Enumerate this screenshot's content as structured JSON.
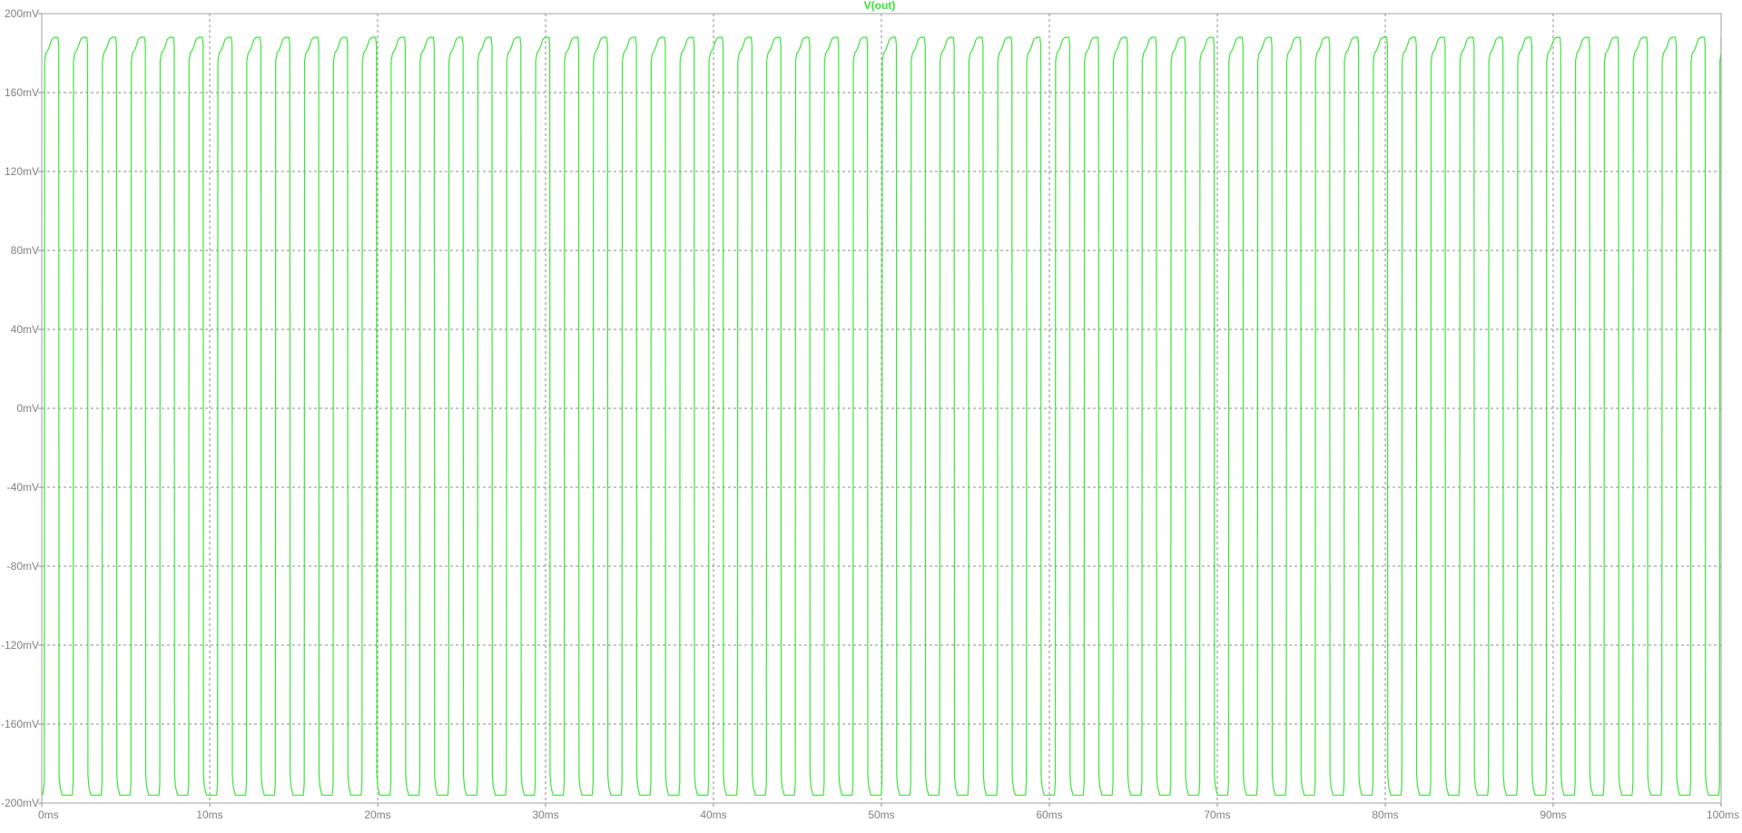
{
  "window": {
    "background": "#ffffff",
    "trace_color": "#3ae63a",
    "grid_color": "#8c8c8c",
    "label_color": "#808080"
  },
  "chart_data": {
    "type": "line",
    "title": "V(out)",
    "xlabel": "",
    "ylabel": "",
    "x_unit": "ms",
    "y_unit": "mV",
    "xlim": [
      0,
      100
    ],
    "ylim": [
      -200,
      200
    ],
    "x_ticks": [
      "0ms",
      "10ms",
      "20ms",
      "30ms",
      "40ms",
      "50ms",
      "60ms",
      "70ms",
      "80ms",
      "90ms",
      "100ms"
    ],
    "y_ticks": [
      "200mV",
      "160mV",
      "120mV",
      "80mV",
      "40mV",
      "0mV",
      "-40mV",
      "-80mV",
      "-120mV",
      "-160mV",
      "-200mV"
    ],
    "x_tick_values": [
      0,
      10,
      20,
      30,
      40,
      50,
      60,
      70,
      80,
      90,
      100
    ],
    "y_tick_values": [
      200,
      160,
      120,
      80,
      40,
      0,
      -40,
      -80,
      -120,
      -160,
      -200
    ],
    "grid": true,
    "series": [
      {
        "name": "V(out)",
        "waveform": "square",
        "period_ms": 1.72,
        "high_mv": 188,
        "high_start_mv": 176,
        "low_mv": -196,
        "low_start_mv": -186,
        "start_ms": 0.15,
        "end_ms": 100
      }
    ]
  }
}
